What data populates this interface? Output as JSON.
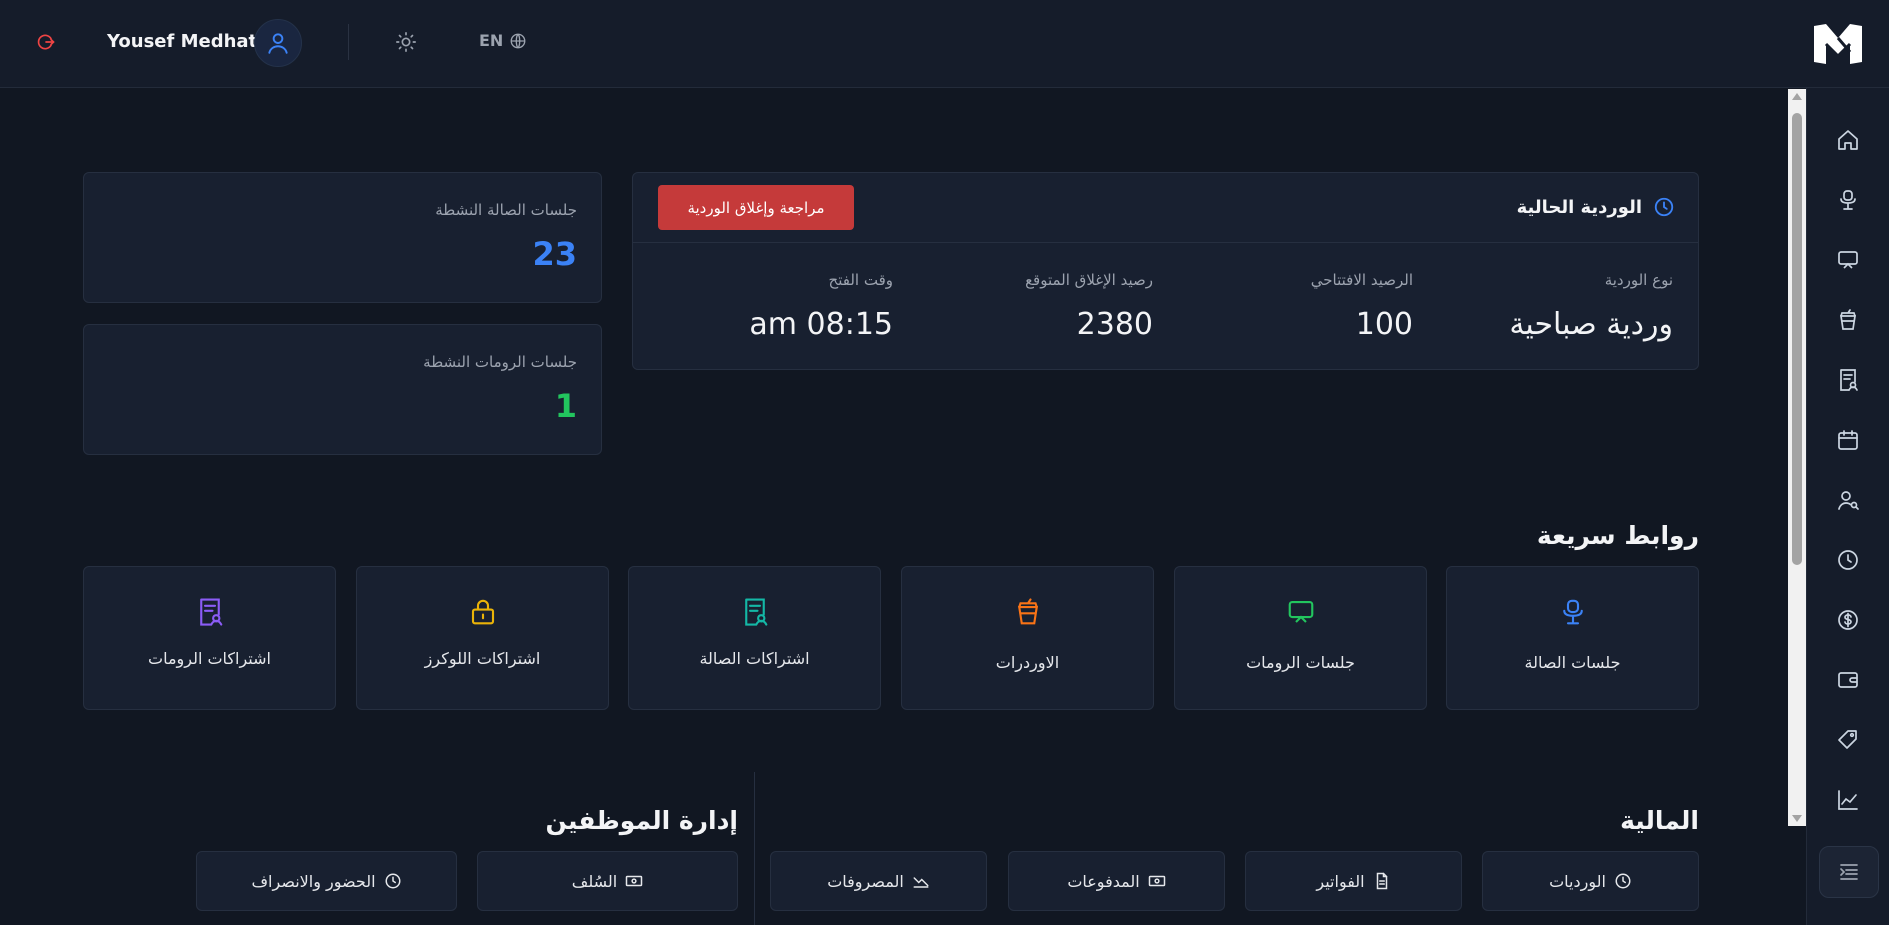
{
  "header": {
    "user_name": "Yousef Medhat",
    "language": "EN",
    "icons": [
      "logout-icon",
      "user-avatar-icon",
      "sun-icon",
      "globe-icon",
      "app-logo"
    ]
  },
  "sidebar": {
    "items": [
      "home-icon",
      "chair-icon",
      "monitor-icon",
      "cup-icon",
      "receipt-icon",
      "calendar-icon",
      "users-icon",
      "clock-icon",
      "dollar-icon",
      "wallet-icon",
      "tag-icon",
      "chart-icon"
    ],
    "toggle_icon": "menu-collapse-icon"
  },
  "stats": [
    {
      "label": "جلسات الصالة النشطة",
      "value": "23",
      "color": "#3b82f6"
    },
    {
      "label": "جلسات الرومات النشطة",
      "value": "1",
      "color": "#22c55e"
    }
  ],
  "shift": {
    "title": "الوردية الحالية",
    "close_button": "مراجعة وإغلاق الوردية",
    "columns": [
      {
        "label": "نوع الوردية",
        "value": "وردية صباحية"
      },
      {
        "label": "الرصيد الافتتاحي",
        "value": "100"
      },
      {
        "label": "رصيد الإغلاق المتوقع",
        "value": "2380"
      },
      {
        "label": "وقت الفتح",
        "value": "08:15 am"
      }
    ]
  },
  "quick_links": {
    "title": "روابط سريعة",
    "items": [
      {
        "label": "جلسات الصالة",
        "icon": "chair-icon",
        "color": "#3b82f6"
      },
      {
        "label": "جلسات الرومات",
        "icon": "monitor-icon",
        "color": "#22c55e"
      },
      {
        "label": "الاوردرات",
        "icon": "cup-icon",
        "color": "#f97316"
      },
      {
        "label": "اشتراكات الصالة",
        "icon": "receipt-icon",
        "color": "#14b8a6"
      },
      {
        "label": "اشتراكات اللوكرز",
        "icon": "lock-icon",
        "color": "#eab308"
      },
      {
        "label": "اشتراكات الرومات",
        "icon": "receipt-icon",
        "color": "#8b5cf6"
      }
    ]
  },
  "finance": {
    "title": "المالية",
    "items": [
      {
        "label": "الورديات",
        "icon": "clock-icon"
      },
      {
        "label": "الفواتير",
        "icon": "document-icon"
      },
      {
        "label": "المدفوعات",
        "icon": "cash-icon"
      },
      {
        "label": "المصروفات",
        "icon": "trend-down-icon"
      }
    ]
  },
  "staff": {
    "title": "إدارة الموظفين",
    "items": [
      {
        "label": "السُلف",
        "icon": "cash-icon"
      },
      {
        "label": "الحضور والانصراف",
        "icon": "clock-icon"
      }
    ]
  }
}
